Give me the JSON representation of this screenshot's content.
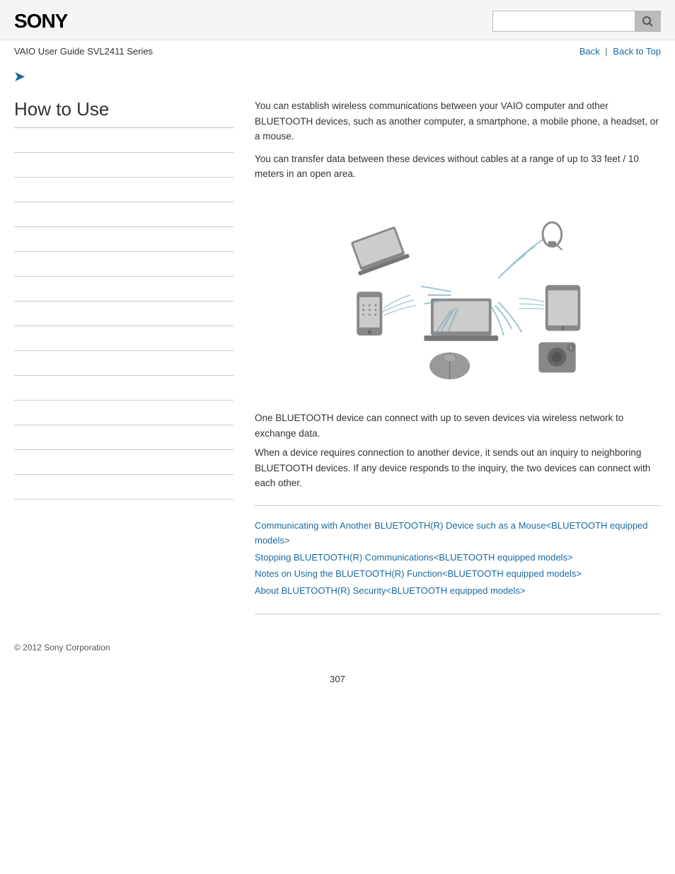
{
  "header": {
    "logo": "SONY",
    "search_placeholder": ""
  },
  "nav": {
    "guide_title": "VAIO User Guide SVL2411 Series",
    "back_label": "Back",
    "back_to_top_label": "Back to Top"
  },
  "sidebar": {
    "title": "How to Use",
    "nav_items": [
      {
        "label": ""
      },
      {
        "label": ""
      },
      {
        "label": ""
      },
      {
        "label": ""
      },
      {
        "label": ""
      },
      {
        "label": ""
      },
      {
        "label": ""
      },
      {
        "label": ""
      },
      {
        "label": ""
      },
      {
        "label": ""
      },
      {
        "label": ""
      },
      {
        "label": ""
      },
      {
        "label": ""
      },
      {
        "label": ""
      },
      {
        "label": ""
      }
    ]
  },
  "content": {
    "para1": "You can establish wireless communications between your VAIO computer and other BLUETOOTH devices, such as another computer, a smartphone, a mobile phone, a headset, or a mouse.",
    "para2": "You can transfer data between these devices without cables at a range of up to 33 feet / 10 meters in an open area.",
    "para3": "One BLUETOOTH device can connect with up to seven devices via wireless network to exchange data.",
    "para4": "When a device requires connection to another device, it sends out an inquiry to neighboring BLUETOOTH devices. If any device responds to the inquiry, the two devices can connect with each other.",
    "related_links": [
      "Communicating with Another BLUETOOTH(R) Device such as a Mouse<BLUETOOTH equipped models>",
      "Stopping BLUETOOTH(R) Communications<BLUETOOTH equipped models>",
      "Notes on Using the BLUETOOTH(R) Function<BLUETOOTH equipped models>",
      "About BLUETOOTH(R) Security<BLUETOOTH equipped models>"
    ]
  },
  "footer": {
    "copyright": "© 2012 Sony Corporation"
  },
  "page_number": "307",
  "colors": {
    "link": "#1a6aa1",
    "border": "#ccc",
    "text": "#333"
  }
}
